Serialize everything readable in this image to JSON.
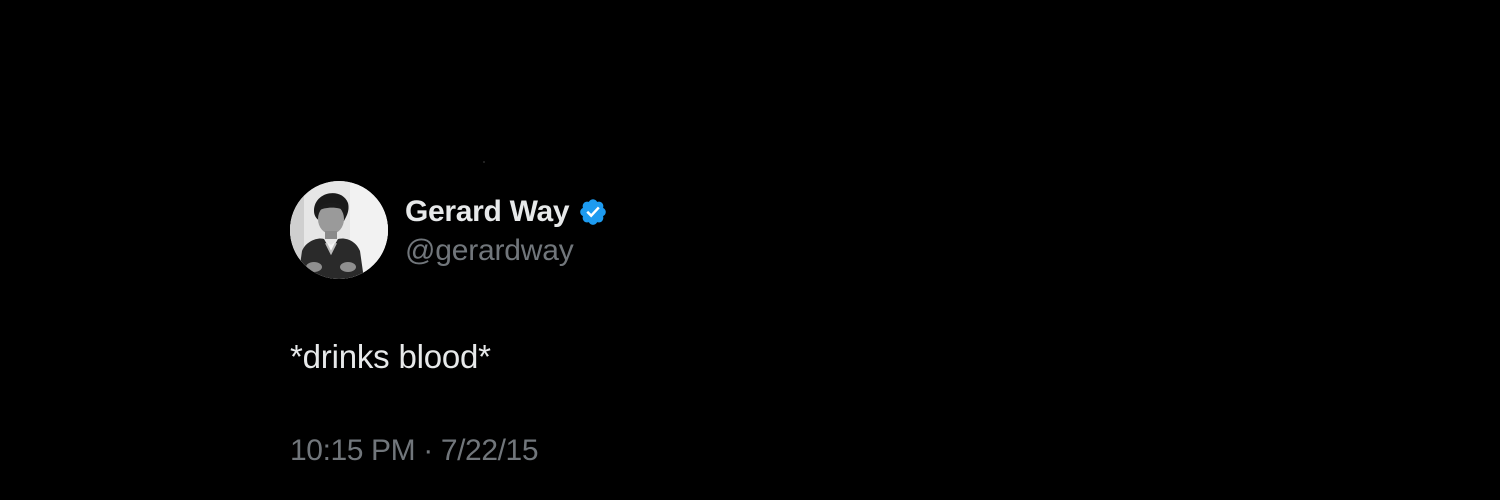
{
  "tweet": {
    "author": {
      "display_name": "Gerard Way",
      "handle": "@gerardway",
      "verified": true,
      "avatar_icon": "profile-photo",
      "verified_icon": "verified-badge-icon"
    },
    "text": "*drinks blood*",
    "time": "10:15 PM",
    "separator": "·",
    "date": "7/22/15"
  },
  "colors": {
    "background": "#000000",
    "primary_text": "#e7e9ea",
    "secondary_text": "#71767b",
    "verified_blue": "#1d9bf0"
  }
}
